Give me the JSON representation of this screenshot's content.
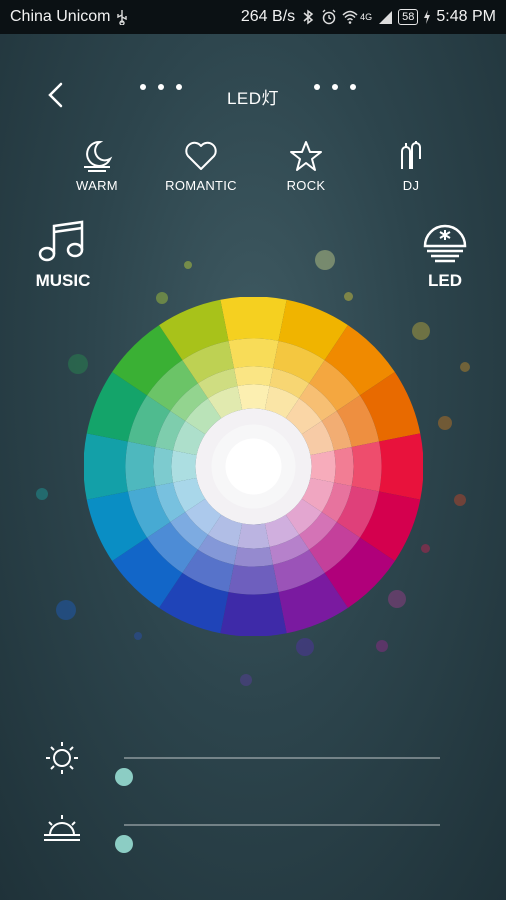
{
  "status_bar": {
    "carrier": "China Unicom",
    "speed": "264 B/s",
    "network": "4G",
    "battery": "58",
    "time": "5:48 PM"
  },
  "header": {
    "title": "LED灯"
  },
  "modes": [
    {
      "label": "WARM",
      "icon": "moon-icon"
    },
    {
      "label": "ROMANTIC",
      "icon": "heart-icon"
    },
    {
      "label": "ROCK",
      "icon": "star-icon"
    },
    {
      "label": "DJ",
      "icon": "dj-icon"
    }
  ],
  "music": {
    "label": "MUSIC",
    "icon": "music-note-icon"
  },
  "led": {
    "label": "LED",
    "icon": "led-lamp-icon"
  },
  "brightness": {
    "icon": "sun-icon",
    "value": 0
  },
  "warmth": {
    "icon": "sunrise-icon",
    "value": 0
  },
  "colors": {
    "accent": "#8ccdc4",
    "wheel_hues": [
      "#f5d020",
      "#f0b400",
      "#f08a00",
      "#e86a00",
      "#e8123c",
      "#d4004e",
      "#b0007a",
      "#7a1aa0",
      "#3e2aa8",
      "#1f44b8",
      "#1266c8",
      "#0a8ec4",
      "#13a0a8",
      "#14a46a",
      "#3ab034",
      "#a8c21a"
    ]
  }
}
